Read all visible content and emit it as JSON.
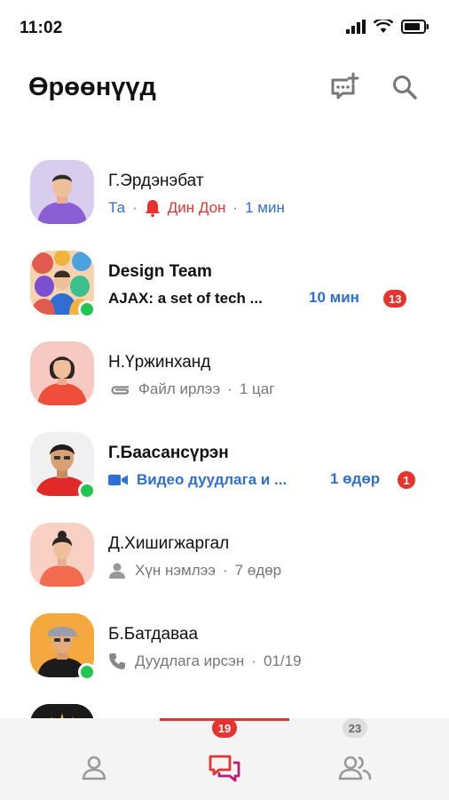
{
  "status_bar": {
    "time": "11:02"
  },
  "header": {
    "title": "Өрөөнүүд"
  },
  "chats": [
    {
      "name": "Г.Эрдэнэбат",
      "sender": "Та",
      "message": "Дин Дон",
      "time": "1 мин",
      "icon": "bell-icon"
    },
    {
      "name": "Design Team",
      "message": "AJAX: a set of tech ...",
      "time": "10 мин",
      "badge": "13",
      "online": true
    },
    {
      "name": "Н.Үржинханд",
      "message": "Файл ирлээ",
      "time": "1 цаг",
      "icon": "paperclip-icon"
    },
    {
      "name": "Г.Баасансүрэн",
      "message": "Видео дуудлага и ...",
      "time": "1 өдөр",
      "badge": "1",
      "online": true,
      "icon": "video-icon"
    },
    {
      "name": "Д.Хишигжаргал",
      "message": "Хүн нэмлээ",
      "time": "7 өдөр",
      "icon": "person-icon"
    },
    {
      "name": "Б.Батдаваа",
      "message": "Дуудлага ирсэн",
      "time": "01/19",
      "online": true,
      "icon": "phone-icon"
    }
  ],
  "tab_bar": {
    "tabs": [
      {
        "icon": "profile-icon"
      },
      {
        "icon": "chat-bubbles-icon",
        "badge": "19",
        "active": true
      },
      {
        "icon": "contacts-icon",
        "badge": "23"
      }
    ]
  },
  "colors": {
    "accent_red": "#e5342f",
    "link_blue": "#2d6fd3",
    "online_green": "#23c552",
    "active_tab_magenta": "#c2187a"
  }
}
